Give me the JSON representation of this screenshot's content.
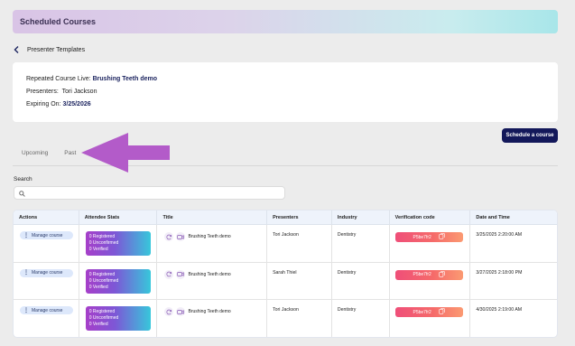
{
  "header": {
    "title": "Scheduled Courses"
  },
  "breadcrumb": {
    "label": "Presenter Templates"
  },
  "course": {
    "line1_label": "Repeated Course Live:",
    "line1_value": "Brushing Teeth demo",
    "line2_label": "Presenters:",
    "line2_value": "Tori Jackson",
    "line3_label": "Expiring On:",
    "line3_value": "3/25/2026"
  },
  "actions": {
    "schedule_label": "Schedule a course"
  },
  "tabs": [
    {
      "label": "Upcoming"
    },
    {
      "label": "Past"
    }
  ],
  "annotation": {
    "arrow_color": "#b35bc9"
  },
  "search": {
    "label": "Search",
    "placeholder": ""
  },
  "table": {
    "headers": [
      "Actions",
      "Attendee Stats",
      "Title",
      "Presenters",
      "Industry",
      "Verification code",
      "Date and Time"
    ],
    "rows": [
      {
        "action": "Manage course",
        "registered": "0 Registered",
        "unconfirmed": "0 Unconfirmed",
        "verified": "0 Verified",
        "title": "Brushing Teeth demo",
        "presenter": "Tori Jackson",
        "industry": "Dentistry",
        "code": "P5be7fr2",
        "datetime": "3/25/2025 2:20:00 AM"
      },
      {
        "action": "Manage course",
        "registered": "0 Registered",
        "unconfirmed": "0 Unconfirmed",
        "verified": "0 Verified",
        "title": "Brushing Teeth demo",
        "presenter": "Sarah Thiel",
        "industry": "Dentistry",
        "code": "P5be7fr2",
        "datetime": "3/27/2025 2:18:00 PM"
      },
      {
        "action": "Manage course",
        "registered": "0 Registered",
        "unconfirmed": "0 Unconfirmed",
        "verified": "0 Verified",
        "title": "Brushing Teeth demo",
        "presenter": "Tori Jackson",
        "industry": "Dentistry",
        "code": "P5be7fr2",
        "datetime": "4/30/2025 2:19:00 AM"
      }
    ]
  }
}
